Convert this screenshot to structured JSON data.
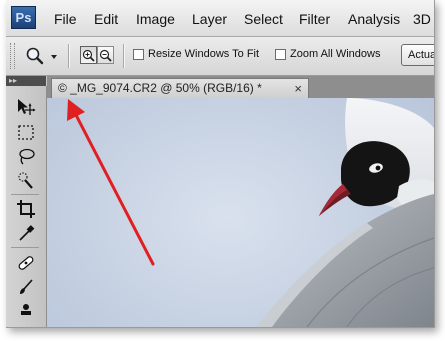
{
  "app": {
    "logo_text": "Ps",
    "menu": [
      "File",
      "Edit",
      "Image",
      "Layer",
      "Select",
      "Filter",
      "Analysis",
      "3D"
    ]
  },
  "options_bar": {
    "tool_icon": "zoom-magnifier-icon",
    "zoom_in_icon": "zoom-in-icon",
    "zoom_out_icon": "zoom-out-icon",
    "resize_windows_label": "Resize Windows To Fit",
    "resize_windows_checked": false,
    "zoom_all_label": "Zoom All Windows",
    "zoom_all_checked": false,
    "actual_pixels_label": "Actual Pixels"
  },
  "tools_panel": {
    "header": "▸▸",
    "tools": [
      "move-tool-icon",
      "marquee-tool-icon",
      "lasso-tool-icon",
      "quick-selection-tool-icon",
      "crop-tool-icon",
      "eyedropper-tool-icon",
      "spot-healing-tool-icon",
      "brush-tool-icon"
    ]
  },
  "document": {
    "tab_title": "© _MG_9074.CR2 @ 50% (RGB/16) *",
    "close_symbol": "×"
  },
  "annotation": {
    "arrow_color": "#e02020"
  }
}
